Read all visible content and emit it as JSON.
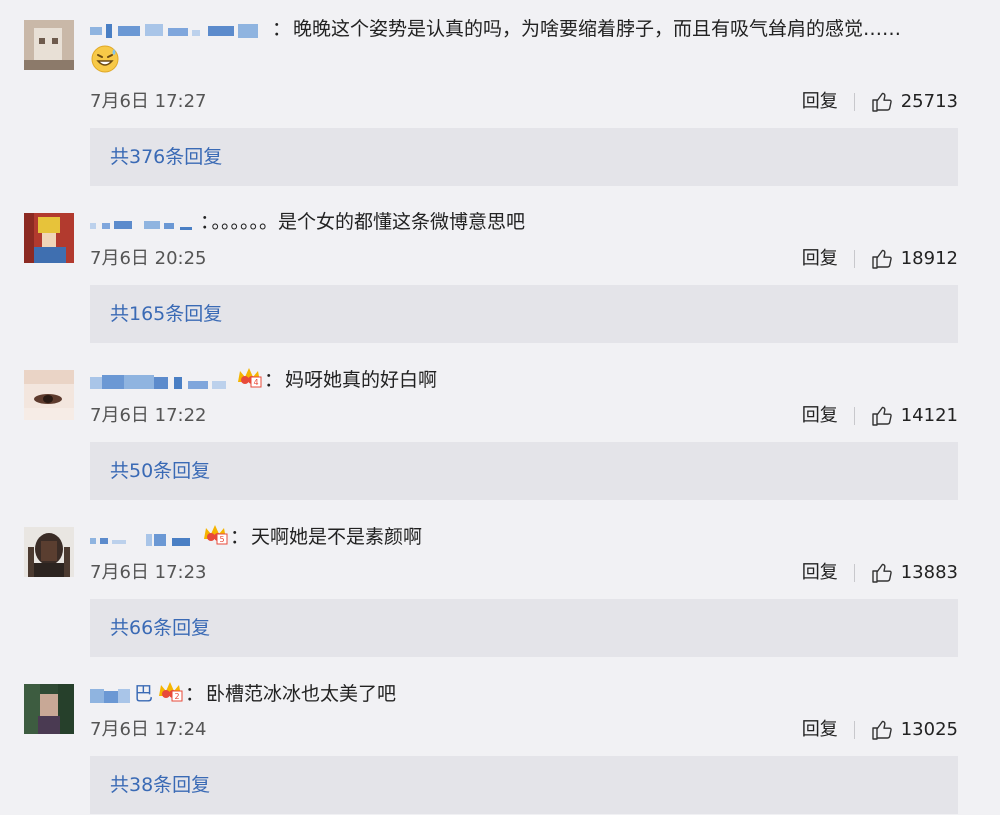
{
  "comments": [
    {
      "text": "晚晚这个姿势是认真的吗，为啥要缩着脖子，而且有吸气耸肩的感觉……",
      "time": "7月6日 17:27",
      "reply_label": "回复",
      "likes": "25713",
      "replies_label": "共376条回复",
      "emoji_icon": "grinning-sweat-emoji-icon"
    },
    {
      "text": "。。。。。。是个女的都懂这条微博意思吧",
      "time": "7月6日 20:25",
      "reply_label": "回复",
      "likes": "18912",
      "replies_label": "共165条回复"
    },
    {
      "text": "妈呀她真的好白啊",
      "time": "7月6日 17:22",
      "reply_label": "回复",
      "likes": "14121",
      "replies_label": "共50条回复",
      "badge_icon": "crown-badge-icon"
    },
    {
      "text": "天啊她是不是素颜啊",
      "time": "7月6日 17:23",
      "reply_label": "回复",
      "likes": "13883",
      "replies_label": "共66条回复",
      "badge_icon": "crown-badge-icon"
    },
    {
      "username_visible_suffix": "巴",
      "text": "卧槽范冰冰也太美了吧",
      "time": "7月6日 17:24",
      "reply_label": "回复",
      "likes": "13025",
      "replies_label": "共38条回复",
      "badge_icon": "crown-badge-icon"
    }
  ],
  "colon": "：",
  "colors": {
    "background": "#f1f1f4",
    "reply_box": "#e4e4e9",
    "link_blue": "#3a6ab5",
    "username_blur": "#8fb4e0"
  }
}
